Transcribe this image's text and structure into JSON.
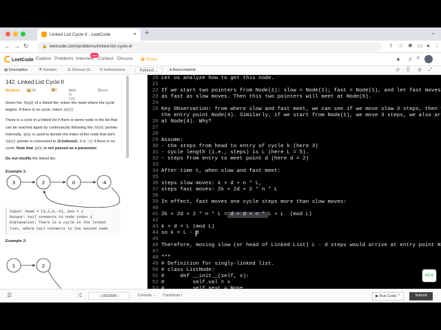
{
  "browser": {
    "tab_title": "Linked List Cycle II - LeetCode",
    "tab_close": "×",
    "new_tab": "+",
    "url": "leetcode.com/problems/linked-list-cycle-ii/"
  },
  "nav": {
    "logo": "LeetCode",
    "links": [
      "Explore",
      "Problems",
      "Interview",
      "Contest",
      "Discuss"
    ],
    "new_badge": "New",
    "store": "Store",
    "notif_count": "0"
  },
  "panel_tabs": [
    "Description",
    "Solution",
    "Discuss (9...",
    "Submissions"
  ],
  "editor_toolbar": {
    "language": "Python3",
    "autocomplete": "Autocomplete"
  },
  "problem": {
    "title": "142. Linked List Cycle II",
    "difficulty": "Medium",
    "likes": "11136",
    "dislikes": "807",
    "add_to_list": "Add to List",
    "share": "Share",
    "p1_a": "Given the ",
    "p1_code1": "head",
    "p1_b": " of a linked list, return ",
    "p1_c": "the node where the cycle begins. If there is no cycle, return ",
    "p1_code2": "null",
    "p1_d": ".",
    "p2_a": "There is a cycle in a linked list if there is some node in the list that can be reached again by continuously following the ",
    "p2_code1": "next",
    "p2_b": " pointer. Internally, ",
    "p2_code2": "pos",
    "p2_c": " is used to denote the index of the node that tail's ",
    "p2_code3": "next",
    "p2_d": " pointer is connected to (",
    "p2_e": "0-indexed",
    "p2_f": "). It is ",
    "p2_code4": "-1",
    "p2_g": " if there is no cycle. ",
    "p2_h": "Note that ",
    "p2_code5": "pos",
    "p2_i": " is not passed as a parameter.",
    "p3_a": "Do not modify",
    "p3_b": " the linked list.",
    "example1": "Example 1:",
    "example1_nodes": [
      "3",
      "2",
      "0",
      "-4"
    ],
    "example1_lines": [
      "Input: head = [3,2,0,-4], pos = 1",
      "Output: tail connects to node index 1",
      "Explanation: There is a cycle in the linked",
      "list, where tail connects to the second node."
    ],
    "example2": "Example 2:",
    "example2_nodes": [
      "1",
      "2"
    ]
  },
  "code_lines": [
    {
      "n": "20",
      "t": "Let us analyze how to get this node."
    },
    {
      "n": "21",
      "t": ""
    },
    {
      "n": "22",
      "t": "If we start two pointers from Node(1): slow = Node(1); fast = Node(1), and let fast moves twice"
    },
    {
      "n": "23",
      "t": "as fast as slow moves. Then this two pointers will meet at Node(6)."
    },
    {
      "n": "24",
      "t": ""
    },
    {
      "n": "25",
      "t": "Key Observation: from where slow and fast meet, we can see if we move slow 3 steps, then we arrive at"
    },
    {
      "n": "",
      "t": "the entry point Node(4). Similarly, if we start from Node(1), we move 3 steps, we also arrive"
    },
    {
      "n": "26",
      "t": "at Node(4). Why?"
    },
    {
      "n": "27",
      "t": ""
    },
    {
      "n": "28",
      "t": ""
    },
    {
      "n": "29",
      "t": "Assume:"
    },
    {
      "n": "30",
      "t": "- the steps from head to entry of cycle k (here 3)"
    },
    {
      "n": "31",
      "t": "- cycle length (i.e., steps) is L (here L = 5)."
    },
    {
      "n": "32",
      "t": "- steps from entry to meet point d (here d = 2)"
    },
    {
      "n": "33",
      "t": ""
    },
    {
      "n": "34",
      "t": "After time t, when slow and fast meet:"
    },
    {
      "n": "35",
      "t": ""
    },
    {
      "n": "36",
      "t": "steps slow moves: k + d + n * L,"
    },
    {
      "n": "37",
      "t": "steps fast moves: 2k + 2d + 2 * n * L"
    },
    {
      "n": "38",
      "t": ""
    },
    {
      "n": "39",
      "t": "In effect, fast moves one cycle steps more than slow moves:"
    },
    {
      "n": "40",
      "t": ""
    },
    {
      "n": "41",
      "t": "2k + 2d + 2 * n * L = d + d + n * L + L  (mod L)"
    },
    {
      "n": "42",
      "t": ""
    },
    {
      "n": "43",
      "t": "k + d = L (mod L)"
    },
    {
      "n": "44",
      "t": "so k = L - d"
    },
    {
      "n": "45",
      "t": ""
    },
    {
      "n": "46",
      "t": "Therefore, moving slow (or head of Linked List) L - d steps would arrive at entry point Node(4)"
    },
    {
      "n": "47",
      "t": ""
    },
    {
      "n": "48",
      "t": "\"\"\""
    },
    {
      "n": "49",
      "t": "# Definition for singly-linked list."
    },
    {
      "n": "50",
      "t": "# class ListNode:"
    },
    {
      "n": "51",
      "t": "#     def __init__(self, x):"
    },
    {
      "n": "52",
      "t": "#         self.val = x"
    },
    {
      "n": "53",
      "t": "#         self.next = None"
    }
  ],
  "new_button": "NEW",
  "bottom": {
    "pager": "142/2585",
    "console": "Console",
    "contribute": "Contribute",
    "run_code": "Run Code",
    "submit": "Submit"
  },
  "colors": {
    "accent": "#ffa116",
    "editor_bg": "#000000",
    "submit_bg": "#424242"
  }
}
